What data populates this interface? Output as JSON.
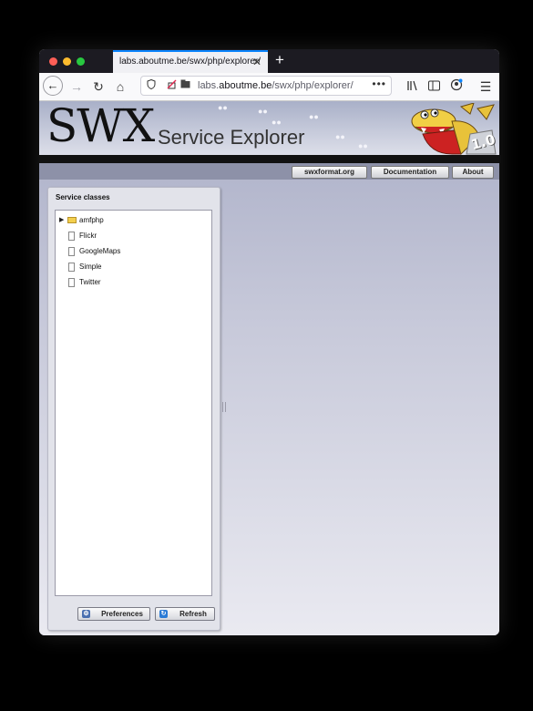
{
  "browser": {
    "tab_title": "labs.aboutme.be/swx/php/explorer/",
    "close_glyph": "✕",
    "new_tab_glyph": "+",
    "url_host": "labs.aboutme.be",
    "url_domain_highlight": "aboutme.be",
    "url_path": "/swx/php/explorer/",
    "url_menu_glyph": "•••",
    "traffic_lights": [
      "#ff5f57",
      "#febc2e",
      "#28c840"
    ],
    "toolbar_icons": [
      "back-icon",
      "forward-icon",
      "reload-icon",
      "home-icon",
      "shield-icon",
      "tracking-blocked-icon",
      "page-icon",
      "library-icon",
      "sidebar-icon",
      "account-icon",
      "menu-icon"
    ]
  },
  "banner": {
    "logo_text": "SWX",
    "subtitle": "Service Explorer",
    "version_badge": "1.0"
  },
  "header_links": [
    "swxformat.org",
    "Documentation",
    "About"
  ],
  "service_panel": {
    "title": "Service classes",
    "items": [
      {
        "label": "amfphp",
        "type": "folder",
        "expandable": true
      },
      {
        "label": "Flickr",
        "type": "file"
      },
      {
        "label": "GoogleMaps",
        "type": "file"
      },
      {
        "label": "Simple",
        "type": "file"
      },
      {
        "label": "Twitter",
        "type": "file"
      }
    ],
    "preferences_label": "Preferences",
    "refresh_label": "Refresh"
  },
  "colors": {
    "accent_tab": "#0a84ff",
    "tabbar": "#1c1b22",
    "content_gradient_top": "#a9adc6",
    "folder": "#f3cf4d"
  }
}
